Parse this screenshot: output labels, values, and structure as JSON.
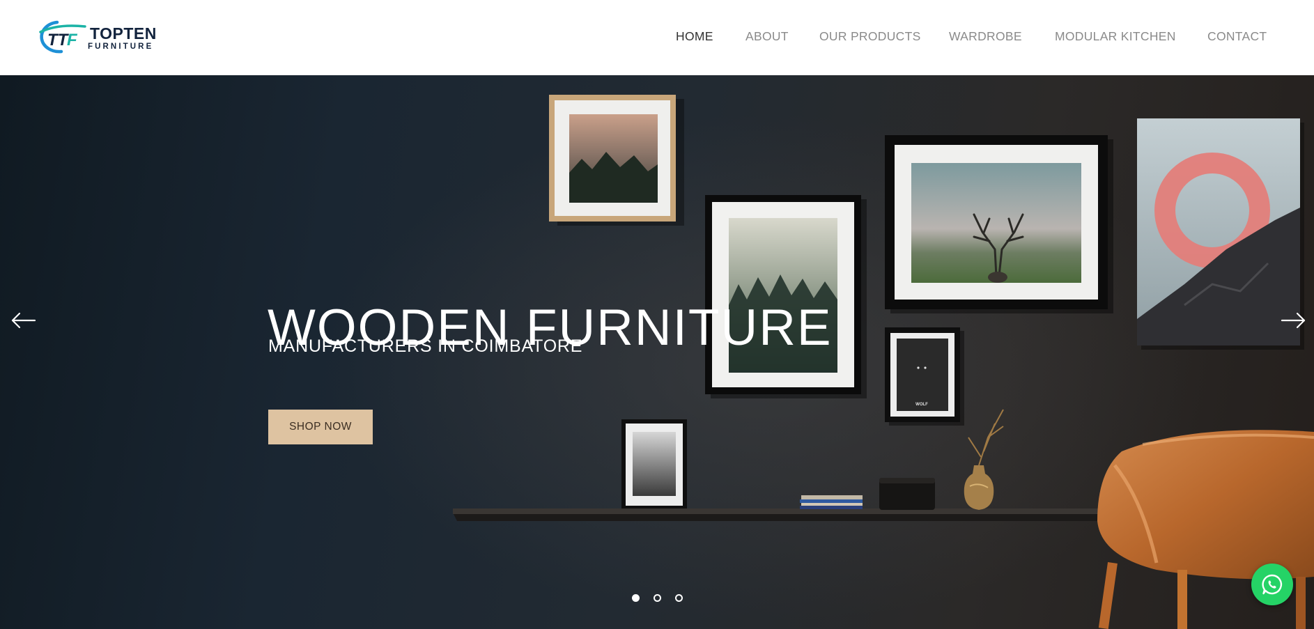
{
  "brand": {
    "name_line1": "TOPTEN",
    "name_line2": "FURNITURE",
    "logo_letters": "TTF",
    "colors": {
      "navy": "#12233d",
      "teal": "#1bb3a6",
      "blue": "#1e90d6"
    }
  },
  "nav": {
    "items": [
      {
        "label": "HOME",
        "active": true
      },
      {
        "label": "ABOUT",
        "active": false
      },
      {
        "label": "OUR PRODUCTS",
        "active": false
      },
      {
        "label": "WARDROBE",
        "active": false
      },
      {
        "label": "MODULAR KITCHEN",
        "active": false
      },
      {
        "label": "CONTACT",
        "active": false
      }
    ]
  },
  "hero": {
    "title": "WOODEN FURNITURE",
    "subtitle": "MANUFACTURERS IN COIMBATORE",
    "cta_label": "SHOP NOW",
    "cta_color": "#dec3a1",
    "prev_icon": "arrow-left-icon",
    "next_icon": "arrow-right-icon",
    "slides_total": 3,
    "current_slide": 1,
    "poster_text": "WOLF"
  },
  "chat": {
    "icon": "whatsapp-icon",
    "color": "#25d366"
  }
}
